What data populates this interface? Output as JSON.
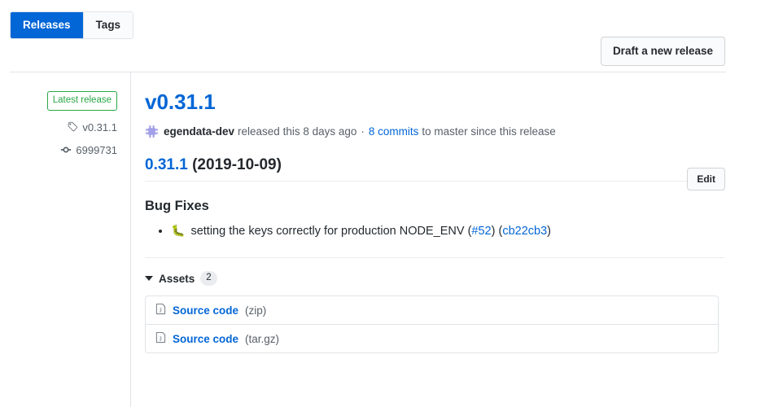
{
  "topbar": {
    "tabs": [
      {
        "label": "Releases",
        "active": true
      },
      {
        "label": "Tags",
        "active": false
      }
    ],
    "draft_button": "Draft a new release"
  },
  "sidebar": {
    "latest_badge": "Latest release",
    "tag_icon": "tag-icon",
    "tag_name": "v0.31.1",
    "commit_icon": "commit-icon",
    "commit_hash": "6999731"
  },
  "release": {
    "title": "v0.31.1",
    "edit_button": "Edit",
    "avatar_icon": "app-avatar-icon",
    "author": "egendata-dev",
    "released_text": "released this 8 days ago",
    "separator": "·",
    "commits_link": "8 commits",
    "commits_suffix": "to master since this release"
  },
  "notes": {
    "version_link": "0.31.1",
    "version_date": "(2019-10-09)",
    "section_heading": "Bug Fixes",
    "items": [
      {
        "emoji": "🐛",
        "text": "setting the keys correctly for production NODE_ENV",
        "issue_open": "(",
        "issue_link": "#52",
        "issue_close": ")",
        "commit_open": "(",
        "commit_link": "cb22cb3",
        "commit_close": ")"
      }
    ]
  },
  "assets": {
    "label": "Assets",
    "count": "2",
    "items": [
      {
        "icon": "file-icon",
        "name": "Source code",
        "ext": "(zip)"
      },
      {
        "icon": "file-icon",
        "name": "Source code",
        "ext": "(tar.gz)"
      }
    ]
  },
  "colors": {
    "accent_blue": "#0366d6",
    "success_green": "#28a745",
    "text_primary": "#24292e",
    "text_muted": "#586069",
    "border": "#e1e4e8"
  }
}
